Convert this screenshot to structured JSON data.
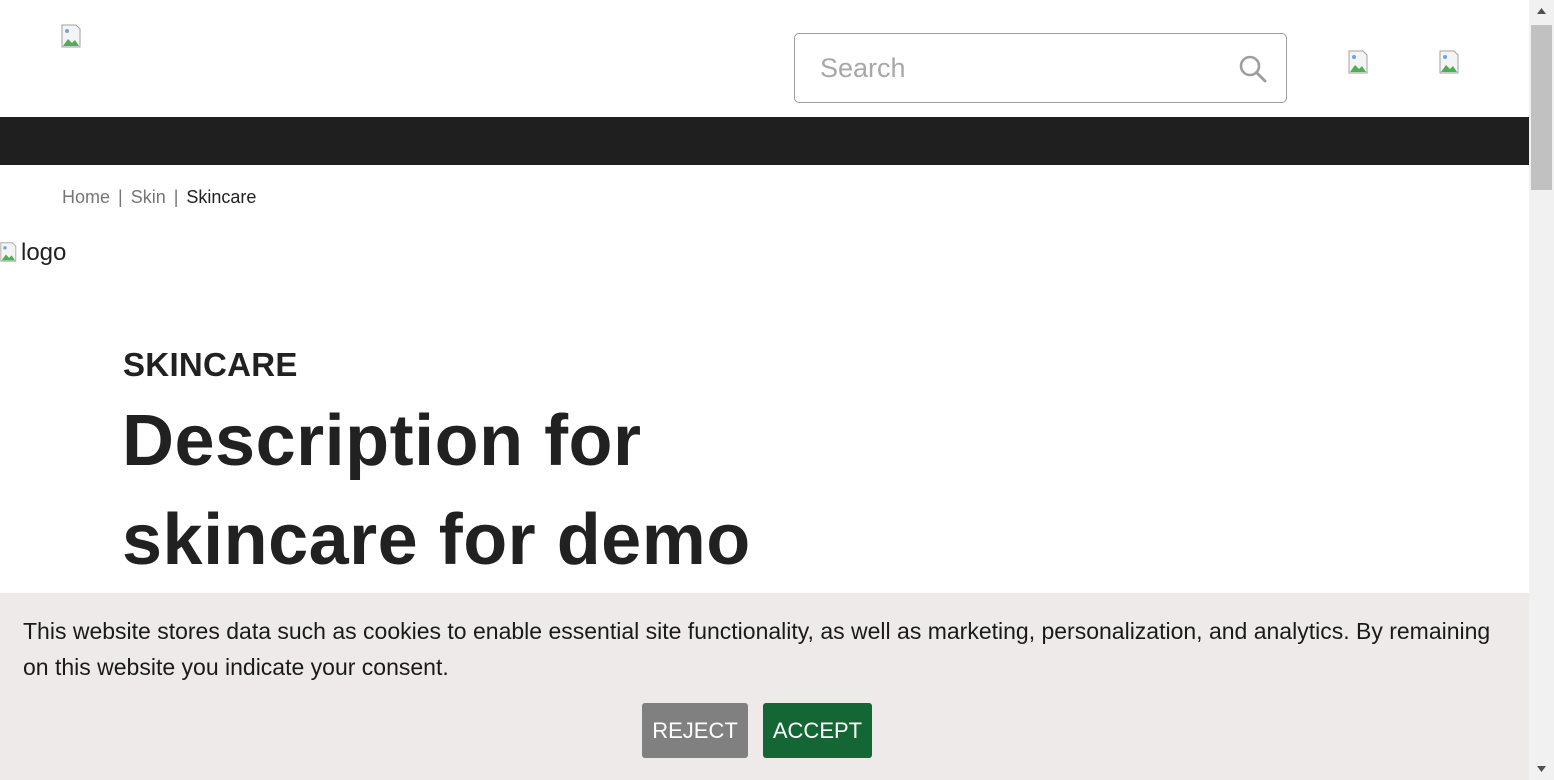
{
  "header": {
    "search": {
      "placeholder": "Search",
      "value": ""
    }
  },
  "breadcrumb": {
    "items": [
      {
        "label": "Home"
      },
      {
        "label": "Skin"
      }
    ],
    "separator": "|",
    "current": "Skincare"
  },
  "banner": {
    "logo_alt": "logo",
    "eyebrow": "SKINCARE",
    "headline": "Description for skincare for demo"
  },
  "cookie": {
    "text": "This website stores data such as cookies to enable essential site functionality, as well as marketing, personalization, and analytics. By remaining on this website you indicate your consent.",
    "reject_label": "REJECT",
    "accept_label": "ACCEPT"
  },
  "colors": {
    "nav_bar": "#1f1f1f",
    "accept_button": "#146635",
    "reject_button": "#808080",
    "cookie_background": "#eeeaea"
  },
  "icons": {
    "search": "search-icon",
    "broken_image": "broken-image-icon"
  }
}
